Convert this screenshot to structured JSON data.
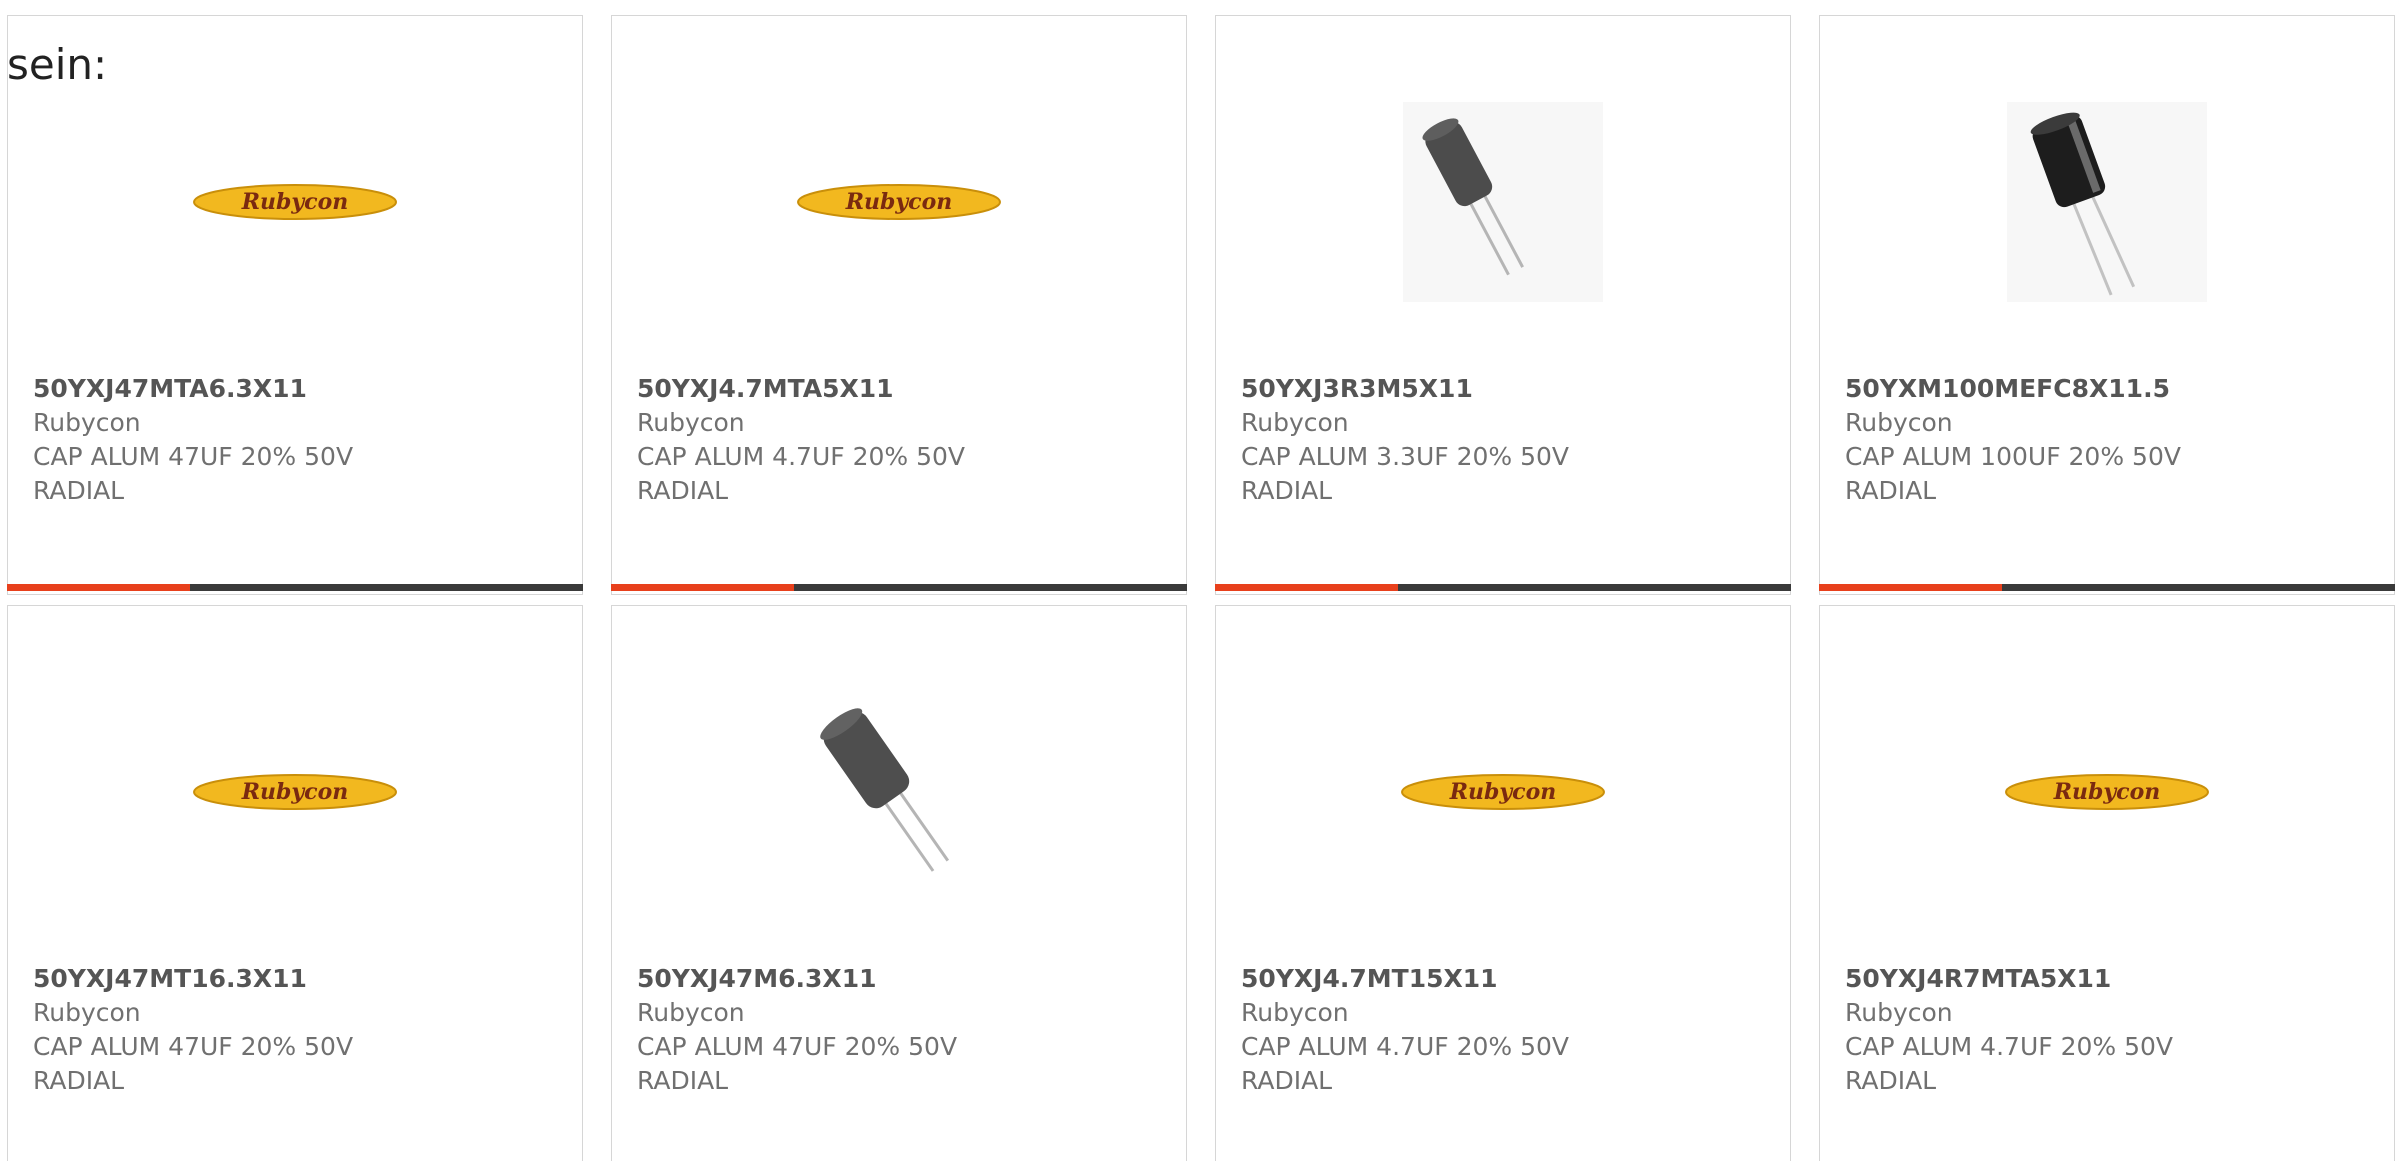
{
  "heading": "sein:",
  "colors": {
    "accent": "#e8401c",
    "bar": "#3a3a3a",
    "logo_fill": "#f2b81f",
    "logo_text": "#7a2a10"
  },
  "cards": [
    {
      "part": "50YXJ47MTA6.3X11",
      "brand": "Rubycon",
      "desc": "CAP ALUM 47UF 20% 50V",
      "package": "RADIAL",
      "image": "rubycon-logo",
      "logo_text": "Rubycon"
    },
    {
      "part": "50YXJ4.7MTA5X11",
      "brand": "Rubycon",
      "desc": "CAP ALUM 4.7UF 20% 50V",
      "package": "RADIAL",
      "image": "rubycon-logo",
      "logo_text": "Rubycon"
    },
    {
      "part": "50YXJ3R3M5X11",
      "brand": "Rubycon",
      "desc": "CAP ALUM 3.3UF 20% 50V",
      "package": "RADIAL",
      "image": "capacitor-photo",
      "logo_text": ""
    },
    {
      "part": "50YXM100MEFC8X11.5",
      "brand": "Rubycon",
      "desc": "CAP ALUM 100UF 20% 50V",
      "package": "RADIAL",
      "image": "capacitor-photo-black",
      "logo_text": ""
    },
    {
      "part": "50YXJ47MT16.3X11",
      "brand": "Rubycon",
      "desc": "CAP ALUM 47UF 20% 50V",
      "package": "RADIAL",
      "image": "rubycon-logo",
      "logo_text": "Rubycon"
    },
    {
      "part": "50YXJ47M6.3X11",
      "brand": "Rubycon",
      "desc": "CAP ALUM 47UF 20% 50V",
      "package": "RADIAL",
      "image": "capacitor-photo",
      "logo_text": ""
    },
    {
      "part": "50YXJ4.7MT15X11",
      "brand": "Rubycon",
      "desc": "CAP ALUM 4.7UF 20% 50V",
      "package": "RADIAL",
      "image": "rubycon-logo",
      "logo_text": "Rubycon"
    },
    {
      "part": "50YXJ4R7MTA5X11",
      "brand": "Rubycon",
      "desc": "CAP ALUM 4.7UF 20% 50V",
      "package": "RADIAL",
      "image": "rubycon-logo",
      "logo_text": "Rubycon"
    }
  ]
}
